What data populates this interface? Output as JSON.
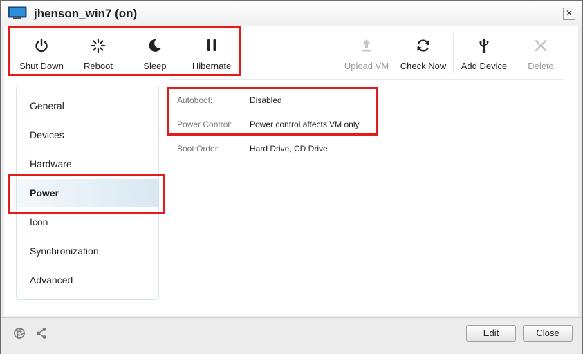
{
  "window": {
    "title": "jhenson_win7 (on)",
    "close_glyph": "✕"
  },
  "toolbar": {
    "power_buttons": [
      {
        "label": "Shut Down",
        "icon": "power-icon"
      },
      {
        "label": "Reboot",
        "icon": "spinner-icon"
      },
      {
        "label": "Sleep",
        "icon": "moon-icon"
      },
      {
        "label": "Hibernate",
        "icon": "pause-icon"
      }
    ],
    "vm_buttons": [
      {
        "label": "Upload VM",
        "icon": "upload-icon",
        "disabled": true
      },
      {
        "label": "Check Now",
        "icon": "refresh-icon",
        "disabled": false
      },
      {
        "label": "Add Device",
        "icon": "usb-icon",
        "disabled": false
      },
      {
        "label": "Delete",
        "icon": "x-icon",
        "disabled": true
      }
    ]
  },
  "sidebar": {
    "items": [
      {
        "label": "General"
      },
      {
        "label": "Devices"
      },
      {
        "label": "Hardware"
      },
      {
        "label": "Power",
        "active": true
      },
      {
        "label": "Icon"
      },
      {
        "label": "Synchronization"
      },
      {
        "label": "Advanced"
      }
    ]
  },
  "properties": [
    {
      "label": "Autoboot:",
      "value": "Disabled"
    },
    {
      "label": "Power Control:",
      "value": "Power control affects VM only"
    },
    {
      "label": "Boot Order:",
      "value": "Hard Drive, CD Drive"
    }
  ],
  "footer": {
    "edit_label": "Edit",
    "close_label": "Close"
  },
  "colors": {
    "highlight": "#e41b1b",
    "active_item": "#d9e8f2",
    "disabled_text": "#9a9a9a"
  }
}
